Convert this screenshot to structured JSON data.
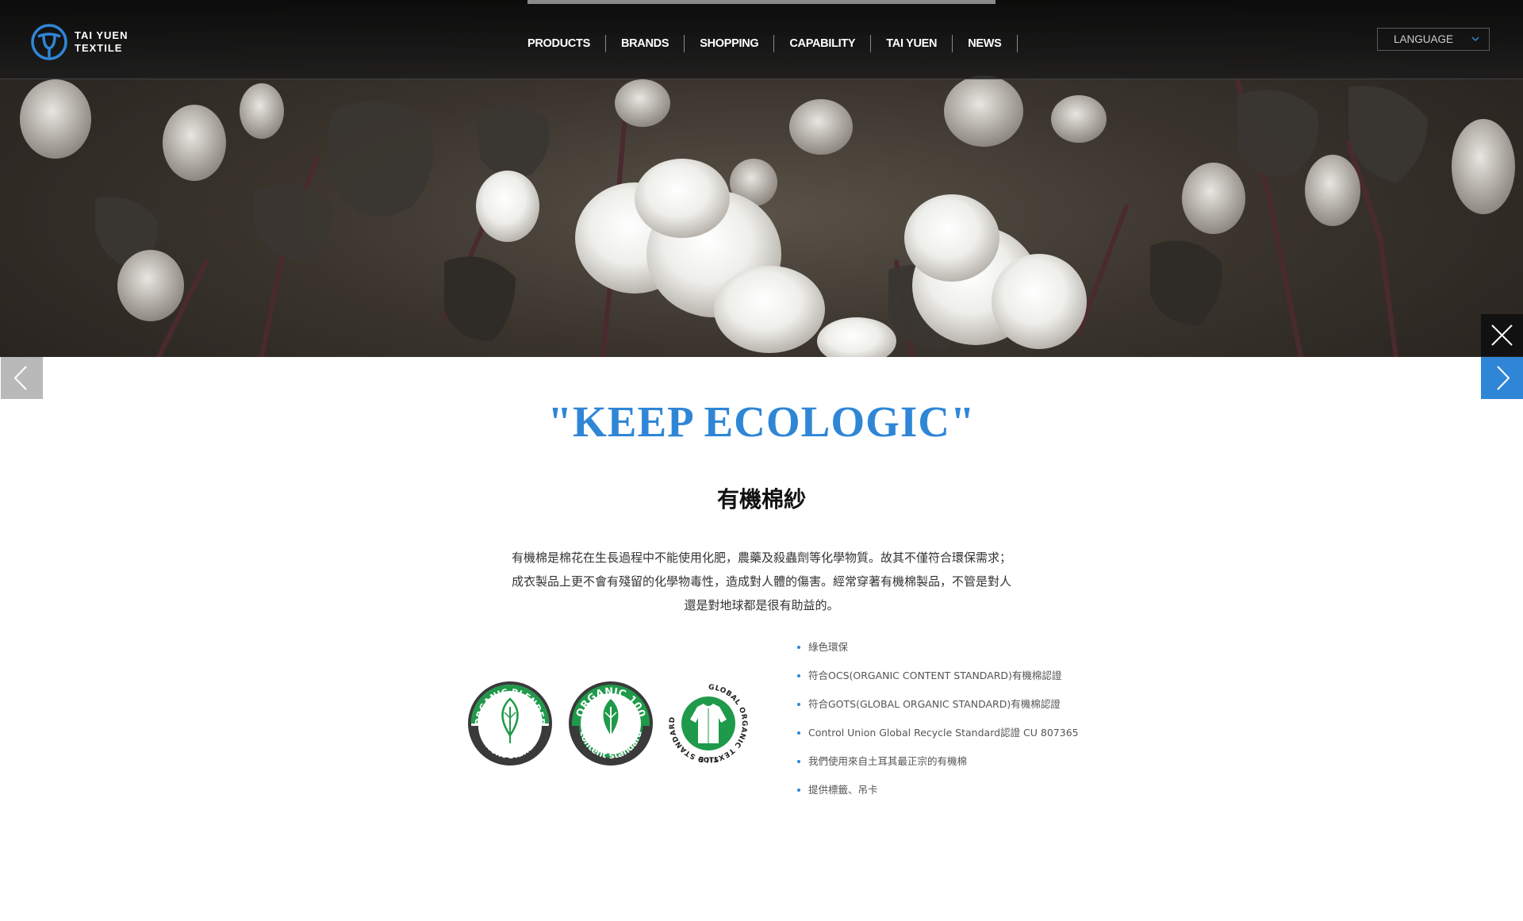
{
  "brand": {
    "name_line1": "TAI YUEN",
    "name_line2": "TEXTILE",
    "color": "#2f86d6"
  },
  "nav": {
    "items": [
      {
        "label": "PRODUCTS"
      },
      {
        "label": "BRANDS"
      },
      {
        "label": "SHOPPING"
      },
      {
        "label": "CAPABILITY"
      },
      {
        "label": "TAI YUEN"
      },
      {
        "label": "NEWS"
      }
    ]
  },
  "language": {
    "label": "LANGUAGE"
  },
  "hero": {
    "image": "cotton-field-photo"
  },
  "controls": {
    "close_icon": "close-icon",
    "next_icon": "chevron-right-icon",
    "prev_icon": "chevron-left-icon"
  },
  "content": {
    "headline": "\"KEEP ECOLOGIC\"",
    "subhead": "有機棉紗",
    "paragraph_lines": [
      "有機棉是棉花在生長過程中不能使用化肥，農藥及殺蟲劑等化學物質。故其不僅符合環保需求；",
      "成衣製品上更不會有殘留的化學物毒性，造成對人體的傷害。經常穿著有機棉製品，不管是對人",
      "還是對地球都是很有助益的。"
    ],
    "badges": [
      {
        "line1": "ORGANIC BLENDED",
        "line2": "content standard",
        "icon": "leaf-outline-icon"
      },
      {
        "line1": "ORGANIC 100",
        "line2": "content standard",
        "icon": "leaf-filled-icon"
      },
      {
        "line1": "GLOBAL ORGANIC TEXTILE STANDARD",
        "line2": "GOTS",
        "icon": "shirt-icon"
      }
    ],
    "features": [
      "綠色環保",
      "符合OCS(ORGANIC CONTENT STANDARD)有機棉認證",
      "符合GOTS(GLOBAL ORGANIC STANDARD)有機棉認證",
      "Control Union Global Recycle Standard認證 CU 807365",
      "我們使用來自土耳其最正宗的有機棉",
      "提供標籤、吊卡"
    ]
  },
  "colors": {
    "accent": "#2f86d6",
    "badge_green": "#1f9a4a",
    "badge_dark": "#3a3a3a",
    "header_bg": "#141414"
  }
}
